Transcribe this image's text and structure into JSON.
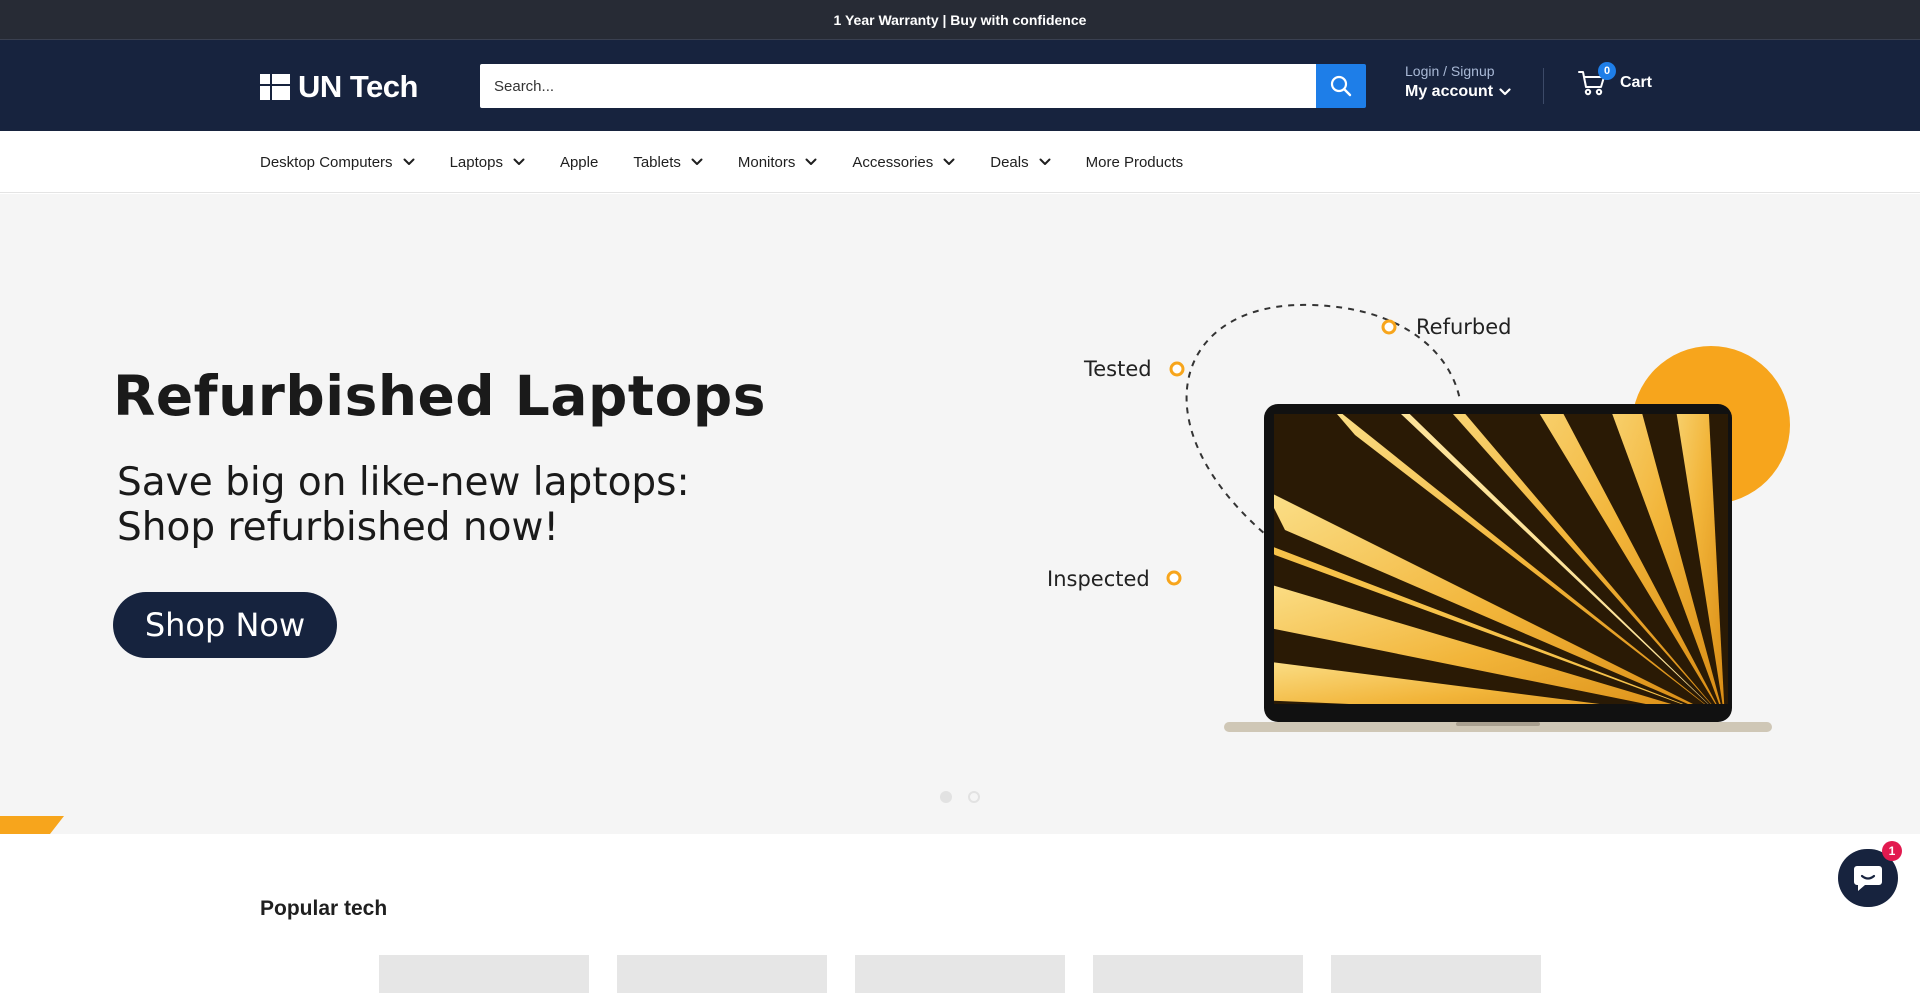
{
  "topbar": {
    "message": "1 Year Warranty | Buy with confidence"
  },
  "header": {
    "logo_text": "UN Tech",
    "search_placeholder": "Search...",
    "login_label": "Login / Signup",
    "account_label": "My account",
    "cart_label": "Cart",
    "cart_count": "0"
  },
  "nav": {
    "items": [
      {
        "label": "Desktop Computers",
        "has_dropdown": true
      },
      {
        "label": "Laptops",
        "has_dropdown": true
      },
      {
        "label": "Apple",
        "has_dropdown": false
      },
      {
        "label": "Tablets",
        "has_dropdown": true
      },
      {
        "label": "Monitors",
        "has_dropdown": true
      },
      {
        "label": "Accessories",
        "has_dropdown": true
      },
      {
        "label": "Deals",
        "has_dropdown": true
      },
      {
        "label": "More Products",
        "has_dropdown": false
      }
    ]
  },
  "hero": {
    "title": "Refurbished Laptops",
    "subtitle_line1": "Save big on like-new laptops:",
    "subtitle_line2": "Shop refurbished now!",
    "button_label": "Shop Now",
    "badge_tested": "Tested",
    "badge_refurbed": "Refurbed",
    "badge_inspected": "Inspected",
    "slide_count": 2,
    "active_slide": 1
  },
  "section": {
    "title": "Popular tech"
  },
  "chat": {
    "badge_count": "1"
  },
  "colors": {
    "topbar_bg": "#272b35",
    "header_bg": "#17233e",
    "accent_blue": "#1e7ee8",
    "accent_orange": "#f7a51c",
    "hero_bg": "#f5f5f5",
    "badge_red": "#e21a4f"
  }
}
